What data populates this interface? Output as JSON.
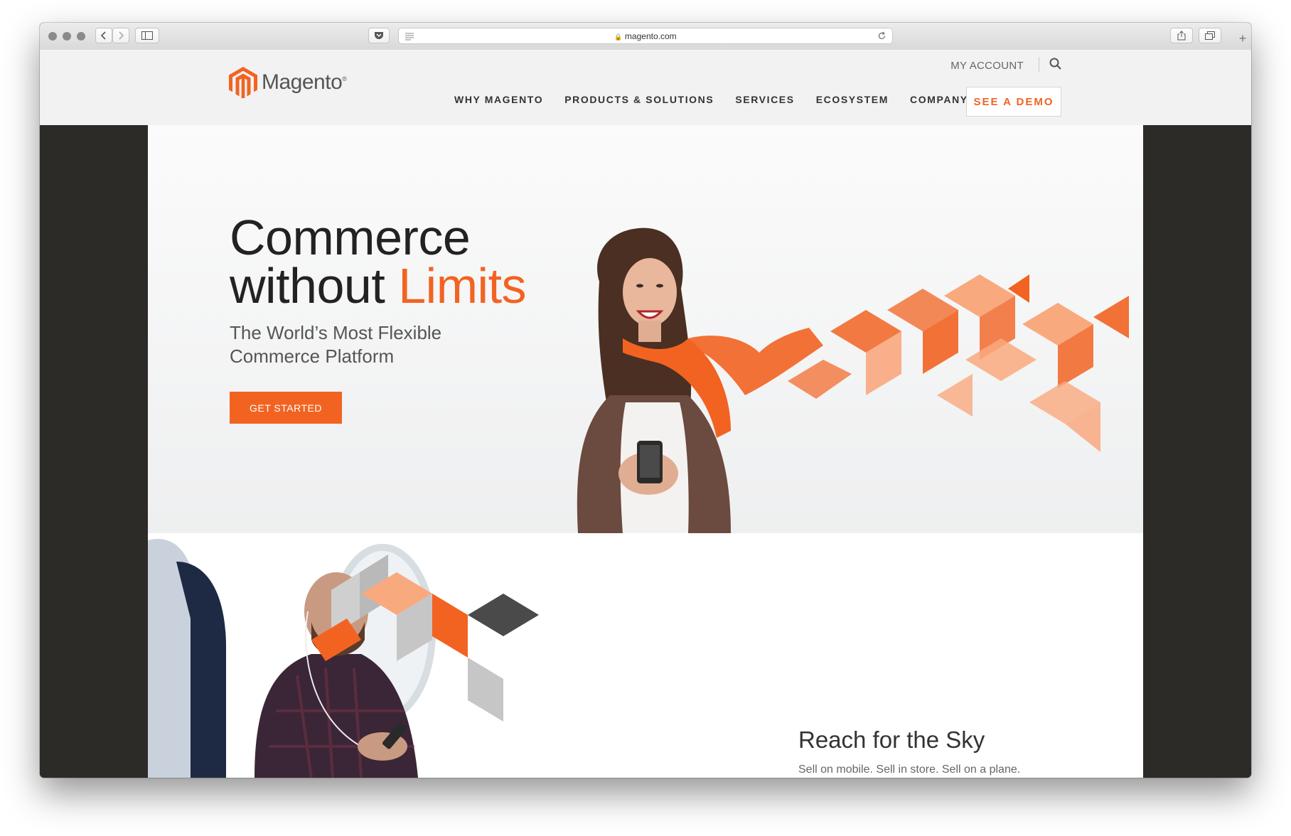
{
  "browser": {
    "url": "magento.com"
  },
  "header": {
    "logo_text": "Magento",
    "logo_mark": "®",
    "my_account": "MY ACCOUNT",
    "nav": [
      {
        "label": "WHY MAGENTO"
      },
      {
        "label": "PRODUCTS & SOLUTIONS"
      },
      {
        "label": "SERVICES"
      },
      {
        "label": "ECOSYSTEM"
      },
      {
        "label": "COMPANY"
      }
    ],
    "demo_button": "SEE A DEMO"
  },
  "hero": {
    "title_line1": "Commerce",
    "title_line2_a": "without ",
    "title_line2_b": "Limits",
    "subtitle_line1": "The World’s Most Flexible",
    "subtitle_line2": "Commerce Platform",
    "cta": "GET STARTED"
  },
  "section2": {
    "title": "Reach for the Sky",
    "subtitle": "Sell on mobile. Sell in store. Sell on a plane."
  },
  "colors": {
    "brand_orange": "#f26322",
    "light_orange": "#f9a97e",
    "dark_gray": "#4a4a4a",
    "light_gray": "#c6c6c6",
    "sidebar": "#2d2b28"
  }
}
